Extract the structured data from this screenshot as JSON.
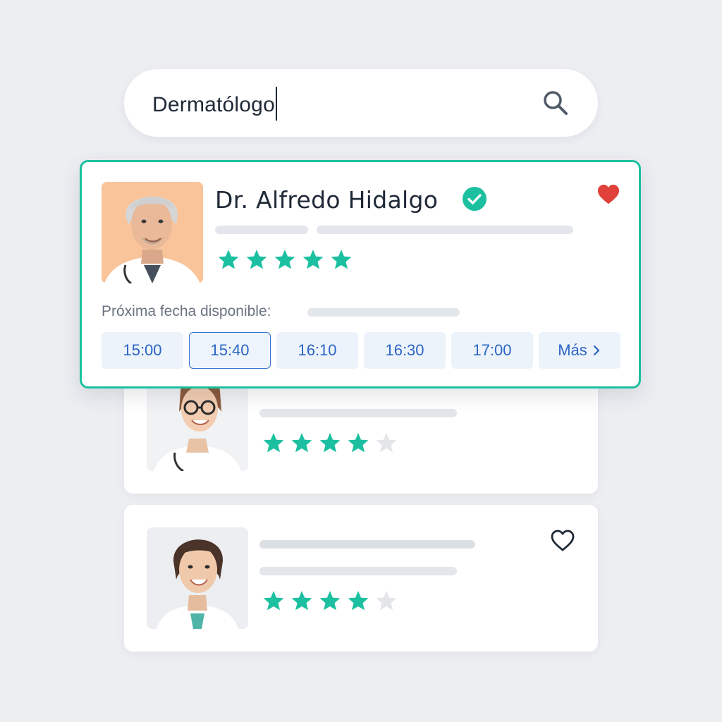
{
  "search": {
    "value": "Dermatólogo"
  },
  "featured_doctor": {
    "name": "Dr. Alfredo Hidalgo",
    "verified": true,
    "favorite": true,
    "rating": 5,
    "next_available_label": "Próxima fecha disponible:",
    "time_slots": [
      "15:00",
      "15:40",
      "16:10",
      "16:30",
      "17:00"
    ],
    "selected_slot": "15:40",
    "more_label": "Más"
  },
  "other_doctors": [
    {
      "rating": 4,
      "favorite": false
    },
    {
      "rating": 4,
      "favorite": false
    }
  ],
  "colors": {
    "accent": "#1cc0a0",
    "star_filled": "#1cc0a0",
    "star_empty": "#e3e5e8",
    "slot_text": "#2a65c4",
    "heart_filled": "#e0413a",
    "background": "#eceef2"
  },
  "icons": {
    "search": "search-icon",
    "verified": "check-circle-icon",
    "favorite_filled": "heart-filled-icon",
    "favorite_outline": "heart-outline-icon",
    "more": "chevron-right-icon",
    "rating": "star-icon"
  }
}
